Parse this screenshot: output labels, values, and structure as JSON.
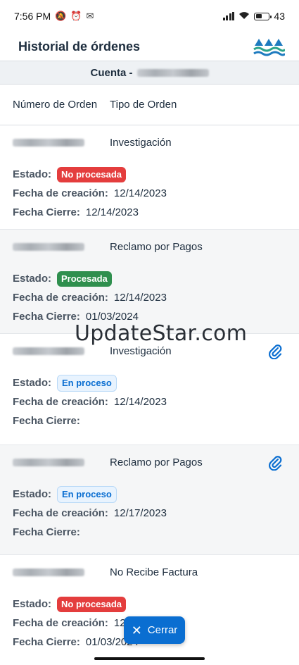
{
  "status_bar": {
    "time": "7:56 PM",
    "left_icons": [
      "mute-icon",
      "alarm-icon",
      "gmail-icon"
    ],
    "battery": "43"
  },
  "header": {
    "title": "Historial de órdenes"
  },
  "account": {
    "label": "Cuenta -"
  },
  "table": {
    "col_number": "Número de Orden",
    "col_type": "Tipo de Orden"
  },
  "labels": {
    "estado": "Estado:",
    "fecha_creacion": "Fecha de creación:",
    "fecha_cierre": "Fecha Cierre:"
  },
  "orders": [
    {
      "type": "Investigación",
      "status": "No procesada",
      "created": "12/14/2023",
      "closed": "12/14/2023"
    },
    {
      "type": "Reclamo por Pagos",
      "status": "Procesada",
      "created": "12/14/2023",
      "closed": "01/03/2024"
    },
    {
      "type": "Investigación",
      "status": "En proceso",
      "created": "12/14/2023",
      "closed": ""
    },
    {
      "type": "Reclamo por Pagos",
      "status": "En proceso",
      "created": "12/17/2023",
      "closed": ""
    },
    {
      "type": "No Recibe Factura",
      "status": "No procesada",
      "created": "12",
      "closed": "01/03/2024"
    }
  ],
  "watermark": "UpdateStar.com",
  "close_button": {
    "label": "Cerrar"
  },
  "colors": {
    "accent": "#0a6ed1",
    "red": "#e43d3d",
    "green": "#2f8f4e"
  }
}
